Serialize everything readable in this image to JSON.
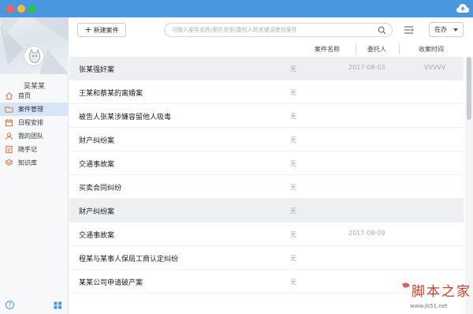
{
  "user": {
    "name": "吴某某"
  },
  "sidebar": {
    "items": [
      {
        "label": "首页",
        "icon": "home-icon",
        "active": false
      },
      {
        "label": "案件管理",
        "icon": "folder-icon",
        "active": true
      },
      {
        "label": "日程安排",
        "icon": "calendar-icon",
        "active": false
      },
      {
        "label": "我的团队",
        "icon": "team-icon",
        "active": false
      },
      {
        "label": "随手记",
        "icon": "note-icon",
        "active": false
      },
      {
        "label": "知识库",
        "icon": "layers-icon",
        "active": false
      }
    ]
  },
  "toolbar": {
    "new_case_label": "新建案件",
    "search_placeholder": "可输入案件名称/案件类型/委托人的关键词查找案件",
    "status_select": "在办"
  },
  "table": {
    "headers": [
      "案件名称",
      "委托人",
      "收案时间"
    ],
    "rows": [
      {
        "title": "张某强奸案",
        "client": "无",
        "date": "2017-08-03",
        "extra": "VVVVV"
      },
      {
        "title": "王某和蔡某的离婚案",
        "client": "无",
        "date": "",
        "extra": ""
      },
      {
        "title": "被告人张某涉嫌容留他人吸毒",
        "client": "无",
        "date": "",
        "extra": ""
      },
      {
        "title": "财产纠纷案",
        "client": "无",
        "date": "",
        "extra": ""
      },
      {
        "title": "交通事故案",
        "client": "无",
        "date": "",
        "extra": ""
      },
      {
        "title": "买卖合同纠纷",
        "client": "无",
        "date": "",
        "extra": ""
      },
      {
        "title": "财产纠纷案",
        "client": "无",
        "date": "",
        "extra": ""
      },
      {
        "title": "交通事故案",
        "client": "无",
        "date": "2017-08-09",
        "extra": ""
      },
      {
        "title": "程某与某事人保局工商认定纠纷",
        "client": "无",
        "date": "",
        "extra": ""
      },
      {
        "title": "某某公司申请破产案",
        "client": "无",
        "date": "",
        "extra": ""
      }
    ]
  },
  "watermark": {
    "text": "脚本之家",
    "url": "www.jb51.net"
  },
  "colors": {
    "accent": "#4a97e0",
    "active_bg": "#d6e6f7",
    "row_alt": "#eeeff1"
  }
}
